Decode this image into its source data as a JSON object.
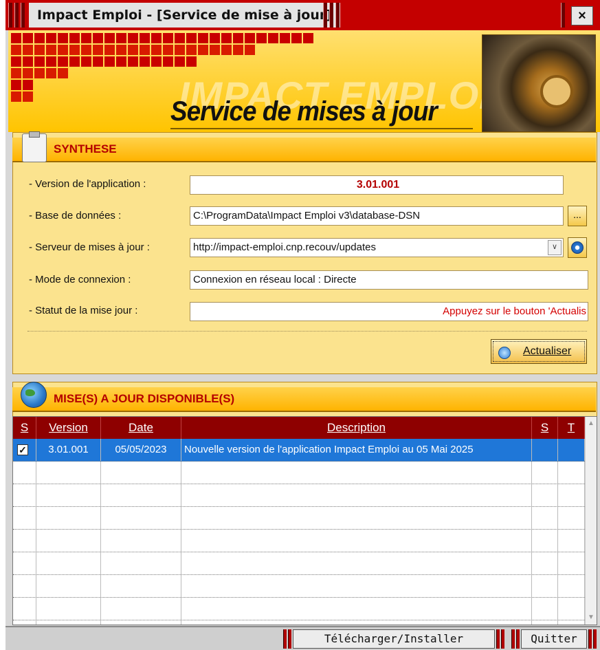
{
  "window": {
    "title": "Impact Emploi - [Service de mise à jour]",
    "close_glyph": "×"
  },
  "banner": {
    "ghost_text": "IMPACT EMPLOI",
    "title": "Service de mises à jour"
  },
  "synthese": {
    "title": "SYNTHESE",
    "fields": [
      {
        "label": "- Version de l'application :",
        "value": "3.01.001"
      },
      {
        "label": "- Base de données :",
        "value": "C:\\ProgramData\\Impact Emploi v3\\database-DSN",
        "button": "..."
      },
      {
        "label": "- Serveur de mises à jour :",
        "value": "http://impact-emploi.cnp.recouv/updates"
      },
      {
        "label": "- Mode de connexion :",
        "value": "Connexion en réseau local : Directe"
      },
      {
        "label": "- Statut de la mise jour :",
        "value": "Appuyez sur le bouton 'Actualis"
      }
    ],
    "refresh_label": "Actualiser"
  },
  "updates": {
    "title": "MISE(S) A JOUR DISPONIBLE(S)",
    "columns": [
      "S",
      "Version",
      "Date",
      "Description",
      "S",
      "T"
    ],
    "rows": [
      {
        "checked": "✓",
        "version": "3.01.001",
        "date": "05/05/2023",
        "description": "Nouvelle version de l'application Impact Emploi au 05 Mai 2025",
        "s": "",
        "t": ""
      }
    ]
  },
  "footer": {
    "download_label": "Télécharger/Installer",
    "quit_label": "Quitter"
  },
  "colors": {
    "title_bar": "#c40000",
    "banner": "#ffc400",
    "header_row": "#8e0000",
    "selected_row": "#1f77d8",
    "status_text": "#d40000",
    "version_text": "#b40000"
  }
}
